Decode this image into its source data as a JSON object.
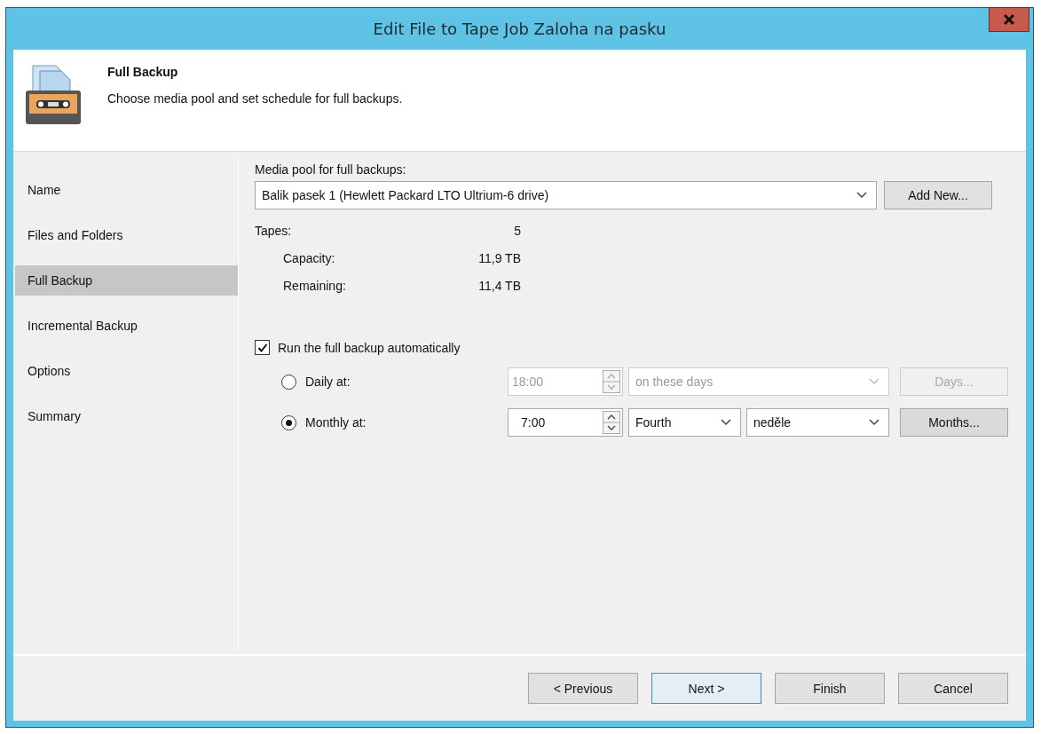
{
  "window": {
    "title": "Edit File to Tape Job Zaloha na pasku"
  },
  "header": {
    "title": "Full Backup",
    "description": "Choose media pool and set schedule for full backups."
  },
  "sidebar": {
    "items": [
      {
        "label": "Name",
        "selected": false
      },
      {
        "label": "Files and Folders",
        "selected": false
      },
      {
        "label": "Full Backup",
        "selected": true
      },
      {
        "label": "Incremental Backup",
        "selected": false
      },
      {
        "label": "Options",
        "selected": false
      },
      {
        "label": "Summary",
        "selected": false
      }
    ]
  },
  "media_pool": {
    "label": "Media pool for full backups:",
    "value": "Balik pasek 1 (Hewlett Packard LTO Ultrium-6 drive)",
    "button": "Add New..."
  },
  "stats": [
    {
      "label": "Tapes:",
      "value": "5",
      "children": [
        {
          "label": "Capacity:",
          "value": "11,9 TB"
        },
        {
          "label": "Remaining:",
          "value": "11,4 TB"
        }
      ]
    }
  ],
  "auto_run": {
    "label": "Run the full backup automatically",
    "checked": true
  },
  "schedules": [
    {
      "label": "Daily at:",
      "selected": false,
      "disabled": true,
      "time": "18:00",
      "selects": [
        "on these days"
      ],
      "button": "Days..."
    },
    {
      "label": "Monthly at:",
      "selected": true,
      "disabled": false,
      "time": "7:00",
      "selects": [
        "Fourth",
        "neděle"
      ],
      "button": "Months..."
    }
  ],
  "footer": {
    "buttons": [
      {
        "label": "< Previous",
        "focused": false
      },
      {
        "label": "Next >",
        "focused": true
      },
      {
        "label": "Finish",
        "focused": false
      },
      {
        "label": "Cancel",
        "focused": false
      }
    ]
  }
}
